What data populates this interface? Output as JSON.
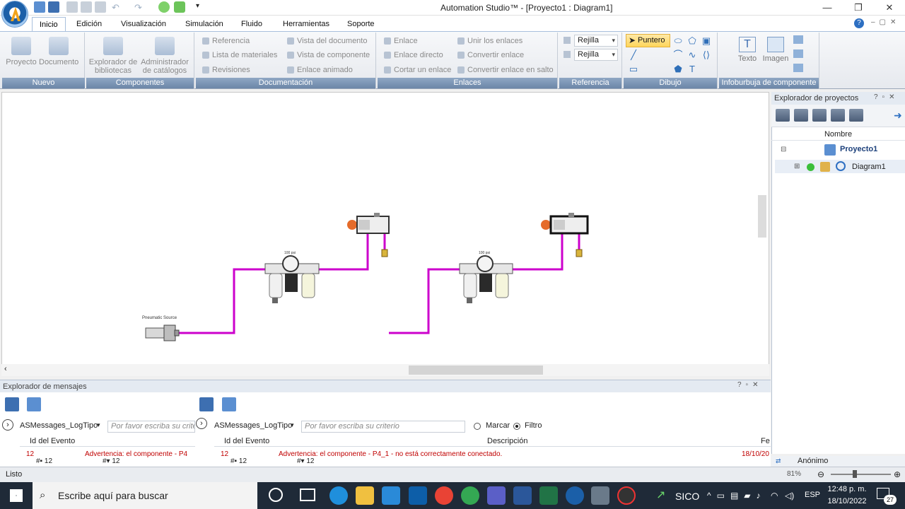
{
  "title_bar": {
    "title": "Automation Studio™ - [Proyecto1 : Diagram1]",
    "minimize": "—",
    "restore": "❐",
    "close": "✕"
  },
  "menu_tabs": [
    "Inicio",
    "Edición",
    "Visualización",
    "Simulación",
    "Fluido",
    "Herramientas",
    "Soporte"
  ],
  "ribbon": {
    "nuevo": {
      "label": "Nuevo",
      "proyecto": "Proyecto",
      "documento": "Documento"
    },
    "componentes": {
      "label": "Componentes",
      "explorador": "Explorador de bibliotecas",
      "admin": "Administrador de catálogos"
    },
    "documentacion": {
      "label": "Documentación",
      "referencia": "Referencia",
      "lista": "Lista de materiales",
      "revisiones": "Revisiones",
      "vista_doc": "Vista del documento",
      "vista_comp": "Vista de componente",
      "enlace_animado": "Enlace animado"
    },
    "enlaces": {
      "label": "Enlaces",
      "enlace": "Enlace",
      "enlace_directo": "Enlace directo",
      "cortar": "Cortar un enlace",
      "unir": "Unir los enlaces",
      "convertir": "Convertir enlace",
      "convertir_salto": "Convertir enlace en salto"
    },
    "referencia": {
      "label": "Referencia",
      "rejilla1": "Rejilla",
      "rejilla2": "Rejilla"
    },
    "dibujo": {
      "label": "Dibujo",
      "puntero": "Puntero"
    },
    "infoburbuja": {
      "label": "Infoburbuja de componente",
      "texto": "Texto",
      "imagen": "Imagen"
    }
  },
  "canvas": {
    "pneumatic_source_label": "Pneumatic Source",
    "frl_label": "100 psi"
  },
  "project_explorer": {
    "title": "Explorador de proyectos",
    "column": "Nombre",
    "project": "Proyecto1",
    "diagram": "Diagram1"
  },
  "message_explorer": {
    "title": "Explorador de mensajes",
    "left": {
      "type_select": "ASMessages_LogTipo",
      "placeholder": "Por favor escriba su crite",
      "col_id": "Id del Evento",
      "row_id": "12",
      "row_text": "Advertencia: el componente - P4",
      "count_a": "12",
      "count_b": "12"
    },
    "right": {
      "type_select": "ASMessages_LogTipo",
      "placeholder": "Por favor escriba su criterio",
      "marcar": "Marcar",
      "filtro": "Filtro",
      "col_id": "Id del Evento",
      "col_desc": "Descripción",
      "col_fecha": "Fe",
      "row_id": "12",
      "row_text": "Advertencia: el componente - P4_1 - no está correctamente conectado.",
      "row_date": "18/10/20",
      "count_a": "12",
      "count_b": "12"
    }
  },
  "status_bar": {
    "status": "Listo",
    "user": "Anónimo",
    "zoom": "81%"
  },
  "taskbar": {
    "search": "Escribe aquí para buscar",
    "sico": "SICO",
    "lang": "ESP",
    "time": "12:48 p. m.",
    "date": "18/10/2022",
    "notif": "27"
  },
  "colors": {
    "pipe": "#cc00cc",
    "accent": "#1b5fa8",
    "ribbon_label": "#7a93b4"
  }
}
